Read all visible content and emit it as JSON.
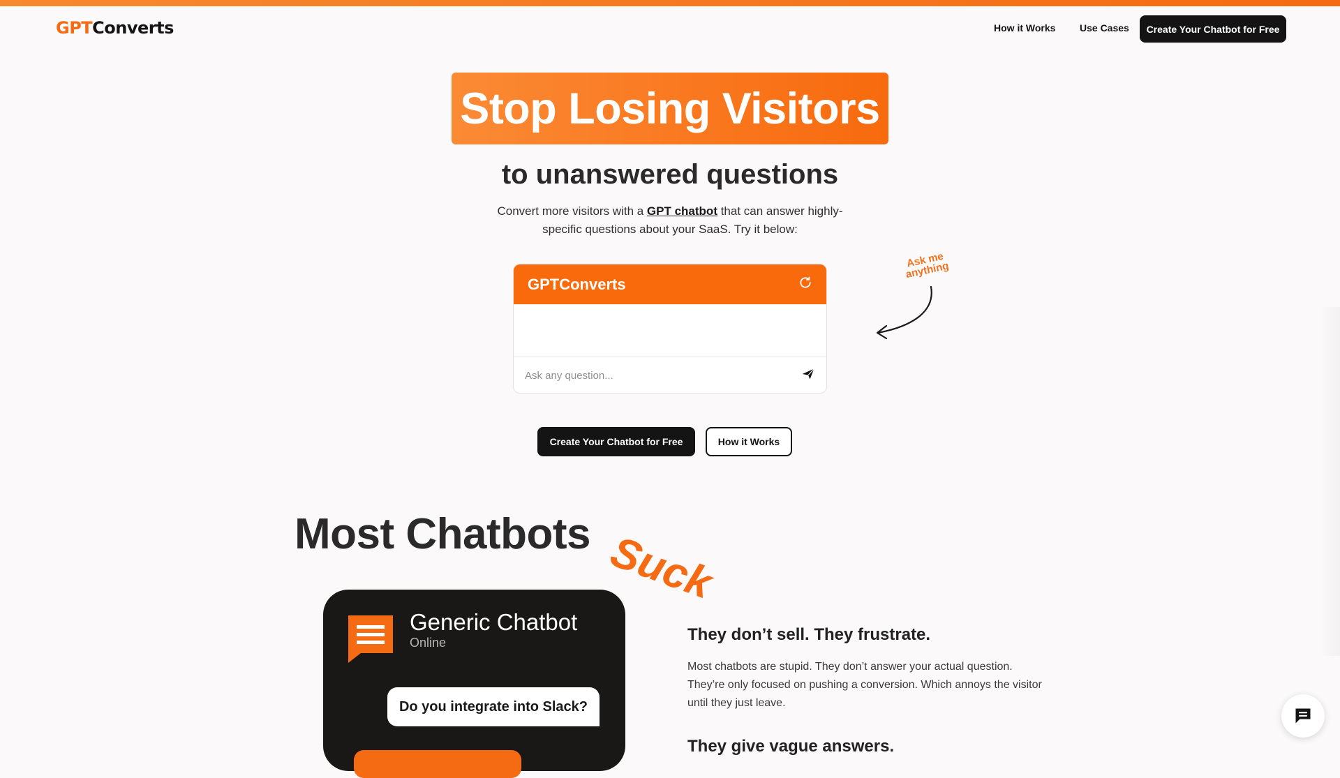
{
  "header": {
    "logo_part1": "GPT",
    "logo_part2": "Converts",
    "nav": [
      {
        "label": "How it Works"
      },
      {
        "label": "Use Cases"
      }
    ],
    "cta_label": "Create Your Chatbot for Free"
  },
  "hero": {
    "headline": "Stop Losing Visitors",
    "subheadline": "to unanswered questions",
    "desc_before": "Convert more visitors with a ",
    "desc_link": "GPT chatbot",
    "desc_after": " that can answer highly-specific questions about your SaaS. Try it below:",
    "primary_cta": "Create Your Chatbot for Free",
    "secondary_cta": "How it Works",
    "annotation": "Ask me anything"
  },
  "chat_widget": {
    "title": "GPTConverts",
    "input_placeholder": "Ask any question...",
    "refresh_icon": "refresh-icon",
    "send_icon": "send-icon"
  },
  "section": {
    "title": "Most Chatbots",
    "accent_word": "Suck",
    "phone": {
      "title": "Generic Chatbot",
      "status": "Online",
      "user_message": "Do you integrate into Slack?",
      "icon": "chat-bubble-icon"
    },
    "points": [
      {
        "heading": "They don’t sell. They frustrate.",
        "body": "Most chatbots are stupid. They don’t answer your actual question. They’re only focused on pushing a conversion. Which annoys the visitor until they just leave."
      },
      {
        "heading": "They give vague answers."
      }
    ]
  },
  "floating_button": {
    "icon": "chat-icon"
  },
  "colors": {
    "accent": "#f56b13",
    "dark": "#141414",
    "background": "#fbf9f9"
  }
}
